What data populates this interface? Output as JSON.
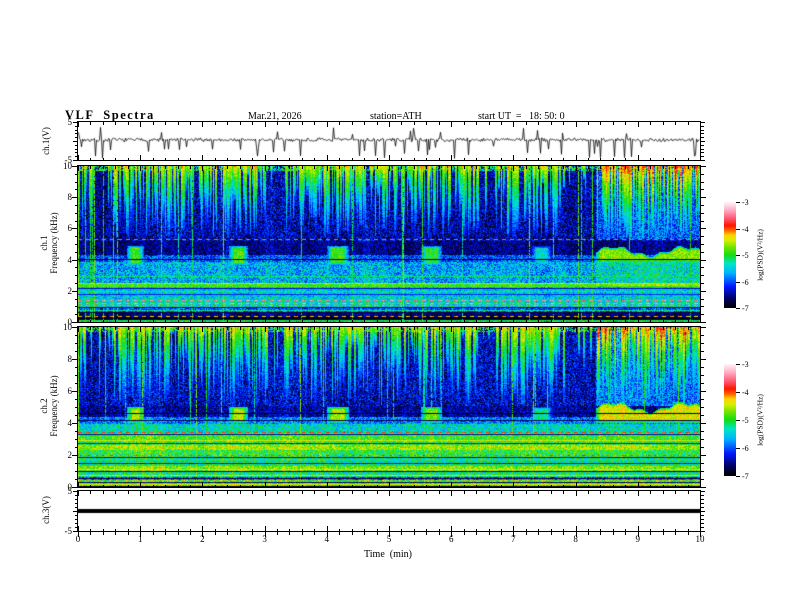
{
  "header": {
    "title": "VLF  Spectra",
    "date": "Mar.21, 2026",
    "station": "station=ATH",
    "start_ut": "start UT  =   18: 50: 0"
  },
  "time_axis": {
    "label": "Time  (min)",
    "min": 0,
    "max": 10,
    "major_ticks": [
      0,
      1,
      2,
      3,
      4,
      5,
      6,
      7,
      8,
      9,
      10
    ],
    "minor_step": 0.2
  },
  "axes": {
    "wave1": {
      "label": "ch.1(V)",
      "min": -5,
      "max": 5,
      "labeled_ticks": [
        5,
        -5
      ],
      "minor_step": 1
    },
    "spec1": {
      "label1": "ch.1",
      "label2": "Frequency  (kHz)",
      "min": 0,
      "max": 10,
      "labeled_ticks": [
        0,
        2,
        4,
        6,
        8,
        10
      ],
      "minor_step": 0.5
    },
    "spec2": {
      "label1": "ch.2",
      "label2": "Frequency  (kHz)",
      "min": 0,
      "max": 10,
      "labeled_ticks": [
        0,
        2,
        4,
        6,
        8,
        10
      ],
      "minor_step": 0.5
    },
    "wave3": {
      "label": "ch.3(V)",
      "min": -5,
      "max": 5,
      "labeled_ticks": [
        5,
        -5
      ],
      "minor_step": 1
    }
  },
  "colorbar": {
    "label": "log(PSD)(V²/Hz)",
    "tick_labels": [
      "-3",
      "-4",
      "-5",
      "-6",
      "-7"
    ],
    "vmax": -3,
    "vmin": -7
  },
  "colormap": [
    [
      0.0,
      "#000000"
    ],
    [
      0.08,
      "#00005a"
    ],
    [
      0.2,
      "#0018ff"
    ],
    [
      0.33,
      "#00b4ff"
    ],
    [
      0.42,
      "#00e6c8"
    ],
    [
      0.5,
      "#14dc14"
    ],
    [
      0.58,
      "#78e600"
    ],
    [
      0.64,
      "#d7ef00"
    ],
    [
      0.69,
      "#ffd200"
    ],
    [
      0.73,
      "#ff6e00"
    ],
    [
      0.78,
      "#ff1400"
    ],
    [
      0.86,
      "#ff6482"
    ],
    [
      0.94,
      "#ffb9cd"
    ],
    [
      1.0,
      "#fff2f5"
    ]
  ],
  "chart_data": [
    {
      "type": "line",
      "panel": "ch1_voltage",
      "ylabel": "ch.1(V)",
      "ylim": [
        -5,
        5
      ],
      "xlim": [
        0,
        10
      ],
      "seed": 7,
      "baseline_mean": 0.3,
      "noise_amp": 0.6,
      "neg_spikes": 46,
      "neg_spike_range": [
        -4.7,
        -1.3
      ],
      "pos_spikes": 14,
      "pos_spike_range": [
        1.6,
        3.6
      ],
      "description": "Noisy channel-1 voltage trace near 0 V with frequent downward impulse spikes (sferics)."
    },
    {
      "type": "heatmap",
      "panel": "ch1_spectrogram",
      "ylabel": "Frequency (kHz)",
      "ylim": [
        0,
        10
      ],
      "xlim": [
        0,
        10
      ],
      "zlabel": "log(PSD)(V²/Hz)",
      "zlim": [
        -7,
        -3
      ],
      "seed": 101,
      "bands": [
        [
          0,
          0.05,
          -5.6,
          0.4
        ],
        [
          0.05,
          0.3,
          -6.9,
          0.2
        ],
        [
          0.3,
          0.55,
          -6.6,
          0.4
        ],
        [
          0.55,
          0.9,
          -6.0,
          0.5
        ],
        [
          0.9,
          1.45,
          -5.35,
          0.45
        ],
        [
          1.45,
          2.25,
          -5.5,
          0.45
        ],
        [
          2.25,
          2.5,
          -4.9,
          0.35
        ],
        [
          2.5,
          3.85,
          -5.65,
          0.5
        ],
        [
          3.85,
          4.3,
          -6.0,
          0.45
        ],
        [
          4.3,
          5.2,
          -6.55,
          0.35
        ],
        [
          5.2,
          10,
          -6.45,
          0.5
        ]
      ],
      "hlines": [
        [
          5.27,
          -4.2,
          "gray"
        ],
        [
          4.02,
          -6.9,
          "solid"
        ],
        [
          2.9,
          -5.15,
          "solid"
        ],
        [
          2.45,
          -4.55,
          "solid"
        ],
        [
          2.3,
          -4.8,
          "solid"
        ],
        [
          2.15,
          -6.4,
          "solid"
        ],
        [
          1.95,
          -5.3,
          "solid"
        ],
        [
          1.75,
          -6.2,
          "solid"
        ],
        [
          1.35,
          -3.45,
          "dash"
        ],
        [
          1.2,
          -3.4,
          "dash"
        ],
        [
          1.05,
          -3.5,
          "dash"
        ],
        [
          0.9,
          -6.5,
          "solid"
        ],
        [
          0.75,
          -5.2,
          "solid"
        ],
        [
          0.6,
          -6.8,
          "solid"
        ],
        [
          0.35,
          -4.25,
          "dash"
        ],
        [
          0.2,
          -6.9,
          "solid"
        ],
        [
          0.08,
          -5.0,
          "solid"
        ]
      ],
      "patches": {
        "f0": 3.6,
        "f1": 4.85,
        "events": [
          [
            0.78,
            1.06,
            -4.85
          ],
          [
            2.42,
            2.73,
            -4.85
          ],
          [
            4.0,
            4.36,
            -4.9
          ],
          [
            5.52,
            5.86,
            -5.0
          ],
          [
            7.28,
            7.62,
            -5.45
          ]
        ],
        "sustained": {
          "t0": 8.32,
          "t1": 10,
          "f0": 3.75,
          "f1": 4.5,
          "v": -4.65
        }
      },
      "streaks": {
        "floor": 5.35,
        "density": 0.8,
        "top_v": -4.6,
        "var": 0.4,
        "fade": 1.8,
        "gaps": [
          [
            0.26,
            0.55
          ],
          [
            3.02,
            3.32
          ],
          [
            6.42,
            6.72
          ],
          [
            7.82,
            8.32
          ]
        ],
        "strong_from": 8.32
      },
      "boosts": [
        {
          "from": 8.32,
          "f0": 5.35,
          "f1": 9.7,
          "add": 0.45
        },
        {
          "from": 8.32,
          "f0": 2.3,
          "f1": 3.85,
          "add": 0.3
        }
      ],
      "full_height_lines": 24,
      "features": [
        "dense impulsive sferic streaks 5.3-10 kHz",
        "quasi-periodic emission patches 3.6-4.9 kHz near t=0.9, 2.6, 4.2, 5.7, 7.4 min",
        "continuous wavy emission band 3.7-4.6 kHz after t=8.3 min",
        "gray interference line at 5.25 kHz",
        "dark quiet band 4.3-5.2 kHz",
        "power-line harmonic horizontal lines below 3 kHz",
        "black band 0.05-0.3 kHz"
      ]
    },
    {
      "type": "heatmap",
      "panel": "ch2_spectrogram",
      "ylabel": "Frequency (kHz)",
      "ylim": [
        0,
        10
      ],
      "xlim": [
        0,
        10
      ],
      "zlabel": "log(PSD)(V²/Hz)",
      "zlim": [
        -7,
        -3
      ],
      "seed": 202,
      "bands": [
        [
          0,
          0.08,
          -6.6,
          0.3
        ],
        [
          0.08,
          0.42,
          -4.8,
          0.5
        ],
        [
          0.42,
          0.6,
          -6.0,
          0.5
        ],
        [
          0.6,
          0.95,
          -5.2,
          0.5
        ],
        [
          0.95,
          1.3,
          -4.7,
          0.4
        ],
        [
          1.3,
          1.9,
          -5.15,
          0.45
        ],
        [
          1.9,
          2.3,
          -5.0,
          0.45
        ],
        [
          2.3,
          2.65,
          -4.6,
          0.35
        ],
        [
          2.65,
          3.35,
          -4.9,
          0.4
        ],
        [
          3.35,
          3.95,
          -5.4,
          0.45
        ],
        [
          3.95,
          4.35,
          -5.85,
          0.45
        ],
        [
          4.35,
          5.05,
          -6.5,
          0.4
        ],
        [
          5.05,
          10,
          -6.4,
          0.5
        ]
      ],
      "hlines": [
        [
          4.6,
          -6.8,
          "solid"
        ],
        [
          4.15,
          -6.7,
          "solid"
        ],
        [
          3.42,
          -3.85,
          "dash"
        ],
        [
          3.28,
          -6.5,
          "solid"
        ],
        [
          2.9,
          -4.45,
          "solid"
        ],
        [
          2.75,
          -6.2,
          "solid"
        ],
        [
          2.0,
          -4.05,
          "dash"
        ],
        [
          1.85,
          -6.4,
          "solid"
        ],
        [
          1.6,
          -5.6,
          "solid"
        ],
        [
          1.45,
          -6.3,
          "solid"
        ],
        [
          1.1,
          -4.4,
          "solid"
        ],
        [
          0.95,
          -6.5,
          "solid"
        ],
        [
          0.7,
          -4.5,
          "solid"
        ],
        [
          0.55,
          -6.7,
          "solid"
        ],
        [
          0.45,
          -3.7,
          "dash"
        ],
        [
          0.3,
          -6.6,
          "solid"
        ],
        [
          0.18,
          -4.4,
          "solid"
        ],
        [
          0.05,
          -6.9,
          "solid"
        ]
      ],
      "patches": {
        "f0": 3.95,
        "f1": 5.0,
        "events": [
          [
            0.78,
            1.06,
            -4.5
          ],
          [
            2.42,
            2.73,
            -4.5
          ],
          [
            4.0,
            4.36,
            -4.55
          ],
          [
            5.52,
            5.86,
            -4.7
          ],
          [
            7.28,
            7.62,
            -5.2
          ]
        ],
        "sustained": {
          "t0": 8.32,
          "t1": 10,
          "f0": 3.95,
          "f1": 4.95,
          "v": -4.4
        }
      },
      "streaks": {
        "floor": 5.05,
        "density": 0.8,
        "top_v": -4.6,
        "var": 0.4,
        "fade": 1.8,
        "gaps": [
          [
            0.26,
            0.55
          ],
          [
            3.02,
            3.32
          ],
          [
            6.42,
            6.72
          ],
          [
            7.82,
            8.32
          ]
        ],
        "strong_from": 8.32
      },
      "boosts": [
        {
          "from": 8.32,
          "f0": 5.05,
          "f1": 9.7,
          "add": 0.5
        }
      ],
      "full_height_lines": 24,
      "features": [
        "dense impulsive sferic streaks 5-10 kHz",
        "quasi-periodic yellow emission patches 4-5 kHz at same times as ch.1",
        "continuous yellow emission band 4-5 kHz after t=8.3 min",
        "red dashed interference line at 3.4 kHz",
        "strong green background below 3.4 kHz with yellow bands at 1.0, 2.45, 2.9 kHz"
      ]
    },
    {
      "type": "line",
      "panel": "ch3_voltage",
      "ylabel": "ch.3(V)",
      "ylim": [
        -5,
        5
      ],
      "xlim": [
        0,
        10
      ],
      "constant_value": 0,
      "line_thickness_px": 4,
      "description": "Flat constant trace at about 0 V (thick black line, no signal)."
    }
  ]
}
